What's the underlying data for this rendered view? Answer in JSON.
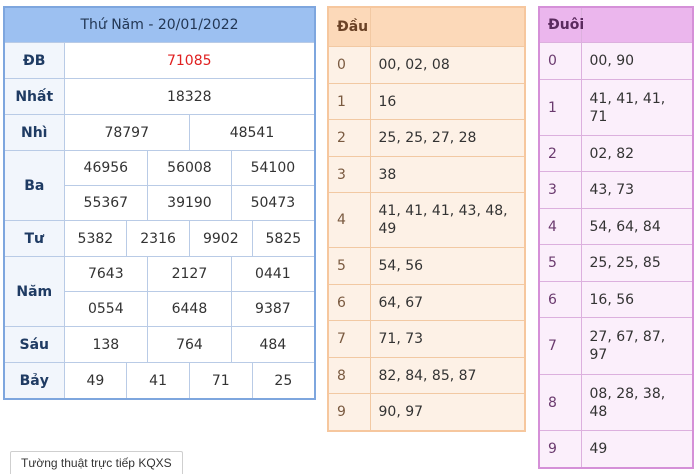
{
  "result": {
    "title": "Thứ Năm - 20/01/2022",
    "prizes": {
      "db": {
        "label": "ĐB",
        "values": [
          "71085"
        ]
      },
      "nhat": {
        "label": "Nhất",
        "values": [
          "18328"
        ]
      },
      "nhi": {
        "label": "Nhì",
        "values": [
          "78797",
          "48541"
        ]
      },
      "ba": {
        "label": "Ba",
        "values": [
          "46956",
          "56008",
          "54100",
          "55367",
          "39190",
          "50473"
        ]
      },
      "tu": {
        "label": "Tư",
        "values": [
          "5382",
          "2316",
          "9902",
          "5825"
        ]
      },
      "nam": {
        "label": "Năm",
        "values": [
          "7643",
          "2127",
          "0441",
          "0554",
          "6448",
          "9387"
        ]
      },
      "sau": {
        "label": "Sáu",
        "values": [
          "138",
          "764",
          "484"
        ]
      },
      "bay": {
        "label": "Bảy",
        "values": [
          "49",
          "41",
          "71",
          "25"
        ]
      }
    }
  },
  "dau": {
    "header": "Đầu",
    "rows": [
      {
        "k": "0",
        "v": "00, 02, 08"
      },
      {
        "k": "1",
        "v": "16"
      },
      {
        "k": "2",
        "v": "25, 25, 27, 28"
      },
      {
        "k": "3",
        "v": "38"
      },
      {
        "k": "4",
        "v": "41, 41, 41, 43, 48, 49"
      },
      {
        "k": "5",
        "v": "54, 56"
      },
      {
        "k": "6",
        "v": "64, 67"
      },
      {
        "k": "7",
        "v": "71, 73"
      },
      {
        "k": "8",
        "v": "82, 84, 85, 87"
      },
      {
        "k": "9",
        "v": "90, 97"
      }
    ]
  },
  "duoi": {
    "header": "Đuôi",
    "rows": [
      {
        "k": "0",
        "v": "00, 90"
      },
      {
        "k": "1",
        "v": "41, 41, 41, 71"
      },
      {
        "k": "2",
        "v": "02, 82"
      },
      {
        "k": "3",
        "v": "43, 73"
      },
      {
        "k": "4",
        "v": "54, 64, 84"
      },
      {
        "k": "5",
        "v": "25, 25, 85"
      },
      {
        "k": "6",
        "v": "16, 56"
      },
      {
        "k": "7",
        "v": "27, 67, 87, 97"
      },
      {
        "k": "8",
        "v": "08, 28, 38, 48"
      },
      {
        "k": "9",
        "v": "49"
      }
    ]
  },
  "footer": {
    "live_button": "Tường thuật trực tiếp KQXS"
  },
  "colors": {
    "jackpot": "#e02020",
    "result_header": "#9cc0f1",
    "dau_header": "#fcd9b9",
    "duoi_header": "#ebb6ed"
  }
}
